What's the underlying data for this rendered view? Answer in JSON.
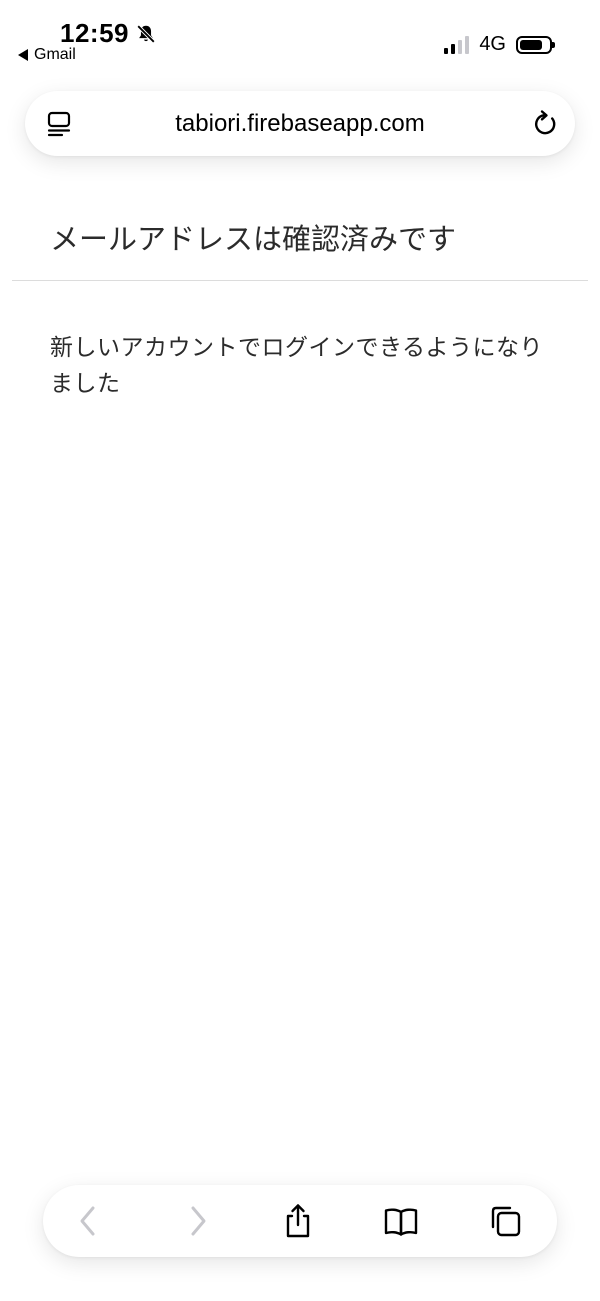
{
  "status_bar": {
    "time": "12:59",
    "back_app_label": "Gmail",
    "network": "4G",
    "signal_bars_active": 2,
    "signal_bars_total": 4,
    "battery_level": 0.8,
    "icons": {
      "silent": "bell-slash-icon",
      "back": "back-triangle-icon",
      "signal": "cellular-signal-icon",
      "battery": "battery-icon"
    }
  },
  "browser": {
    "url": "tabiori.firebaseapp.com",
    "icons": {
      "page_menu": "page-menu-icon",
      "reload": "reload-icon"
    }
  },
  "page": {
    "title": "メールアドレスは確認済みです",
    "message": "新しいアカウントでログインできるようになりました"
  },
  "toolbar": {
    "buttons": [
      {
        "icon": "back-icon",
        "enabled": false
      },
      {
        "icon": "forward-icon",
        "enabled": false
      },
      {
        "icon": "share-icon",
        "enabled": true
      },
      {
        "icon": "bookmarks-icon",
        "enabled": true
      },
      {
        "icon": "tabs-icon",
        "enabled": true
      }
    ]
  },
  "colors": {
    "text_primary": "#2b2b2b",
    "icon_active": "#000000",
    "icon_disabled": "#c7c7cc",
    "divider": "#dcdcdc",
    "signal_inactive": "#c7c7cc"
  }
}
